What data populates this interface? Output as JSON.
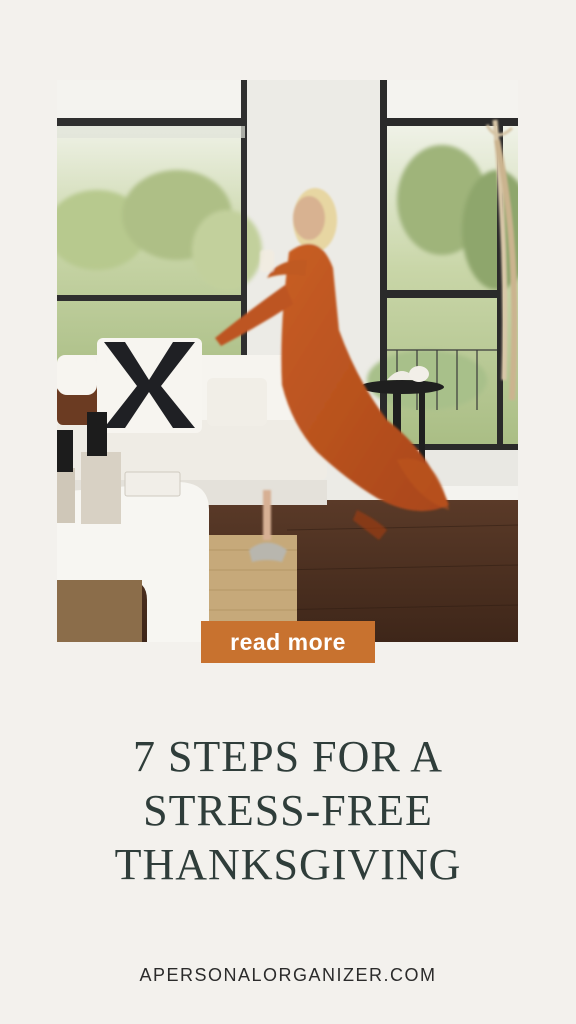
{
  "pin": {
    "image_alt": "Woman in a flowing rust-orange dress dancing in a bright living room",
    "button_label": "read more",
    "title_lines": [
      "7 STEPS FOR A",
      "STRESS-FREE",
      "THANKSGIVING"
    ],
    "website": "APERSONALORGANIZER.COM"
  },
  "colors": {
    "background": "#f3f1ed",
    "button": "#c8722f",
    "title_text": "#2f3d3a",
    "dress": "#c0581f"
  }
}
